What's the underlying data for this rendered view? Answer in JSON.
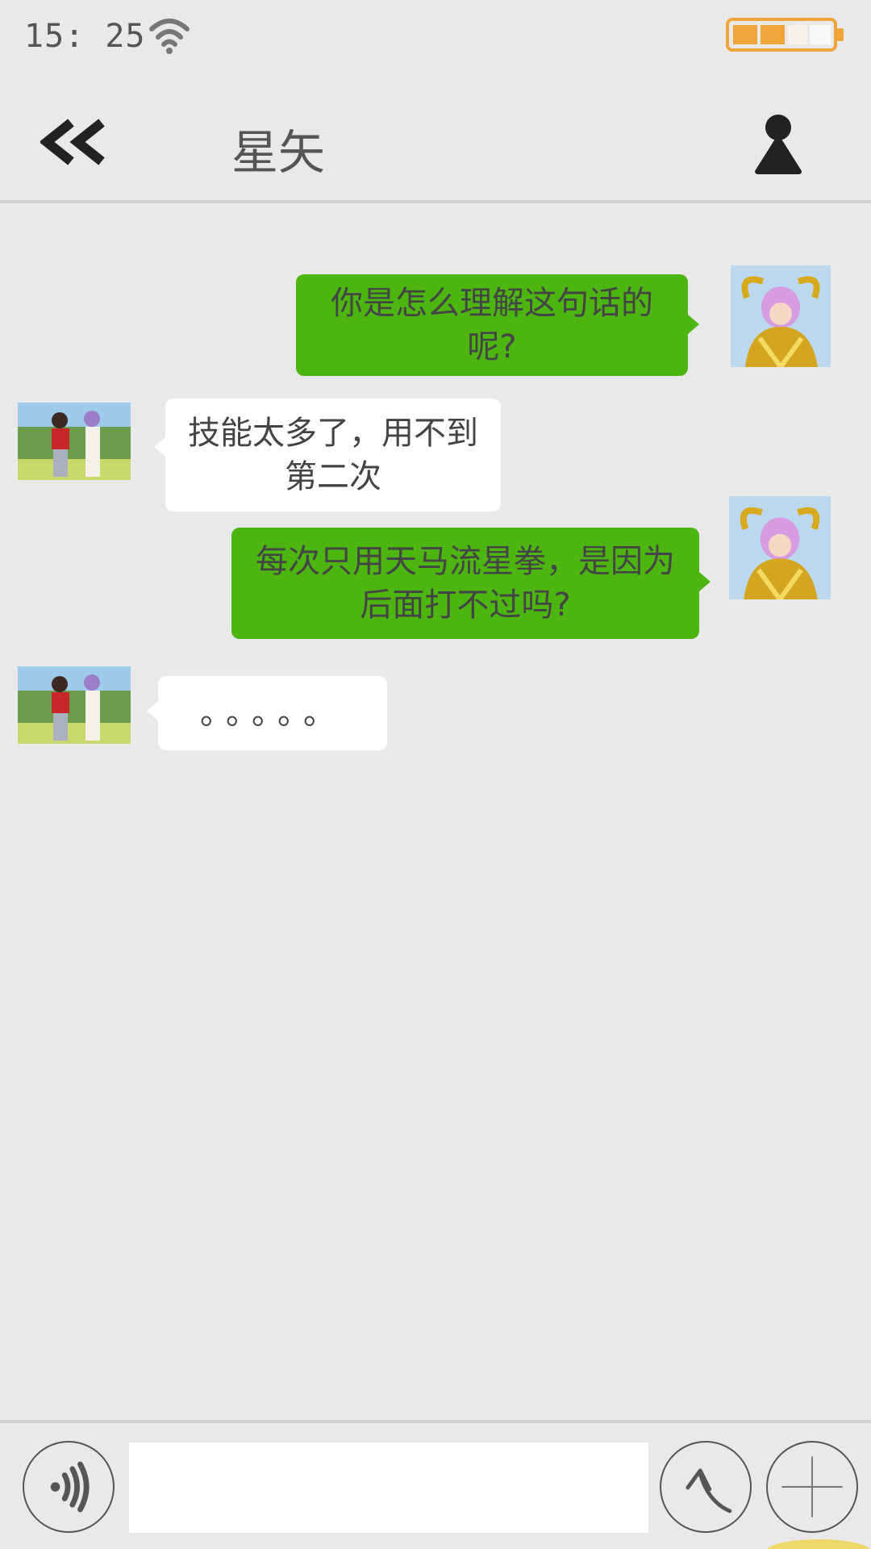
{
  "status_bar": {
    "time": "15: 25",
    "icons": [
      "wifi-icon",
      "battery-icon"
    ],
    "battery_color": "#f0a53a"
  },
  "header": {
    "title": "星矢",
    "back_icon": "double-chevron-left-icon",
    "profile_icon": "person-icon"
  },
  "colors": {
    "background": "#e9e9e9",
    "sent_bubble": "#4db510",
    "received_bubble": "#ffffff"
  },
  "messages": [
    {
      "from": "me",
      "lines": [
        "你是怎么理解这句话的",
        "呢?"
      ]
    },
    {
      "from": "other",
      "lines": [
        "技能太多了，用不到",
        "第二次"
      ]
    },
    {
      "from": "me",
      "lines": [
        "每次只用天马流星拳，是因为",
        "后面打不过吗?"
      ]
    },
    {
      "from": "other",
      "lines": [
        "。。。。。"
      ]
    }
  ],
  "input_bar": {
    "placeholder": "",
    "value": "",
    "icons": [
      "voice-icon",
      "send-icon",
      "plus-icon"
    ]
  }
}
